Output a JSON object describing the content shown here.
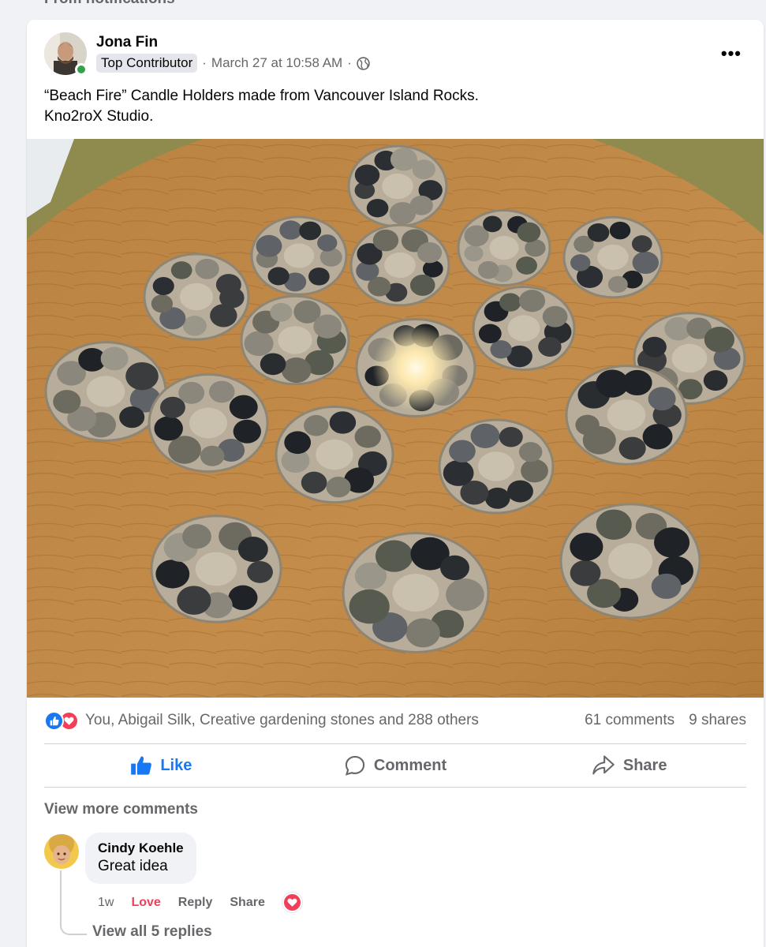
{
  "top_notice": "From notifications",
  "post": {
    "author": "Jona Fin",
    "badge": "Top Contributor",
    "separator": "·",
    "timestamp": "March 27 at 10:58 AM",
    "privacy_icon": "globe-icon",
    "more_icon": "•••",
    "text_line1": "“Beach Fire” Candle Holders made from Vancouver Island Rocks.",
    "text_line2": "Kno2roX Studio."
  },
  "reactions": {
    "icons": [
      "like-reaction-icon",
      "love-reaction-icon"
    ],
    "names": "You, Abigail Silk, Creative gardening stones and 288 others",
    "comments": "61 comments",
    "shares": "9 shares"
  },
  "actions": {
    "like": "Like",
    "comment": "Comment",
    "share": "Share"
  },
  "comments": {
    "view_more": "View more comments",
    "items": [
      {
        "author": "Cindy Koehle",
        "text": "Great idea",
        "time": "1w",
        "love": "Love",
        "reply": "Reply",
        "share": "Share",
        "view_replies": "View all 5 replies"
      }
    ]
  },
  "colors": {
    "accent": "#1877f2",
    "love": "#f33e58",
    "online": "#31a24c",
    "secondary_text": "#65676b"
  }
}
